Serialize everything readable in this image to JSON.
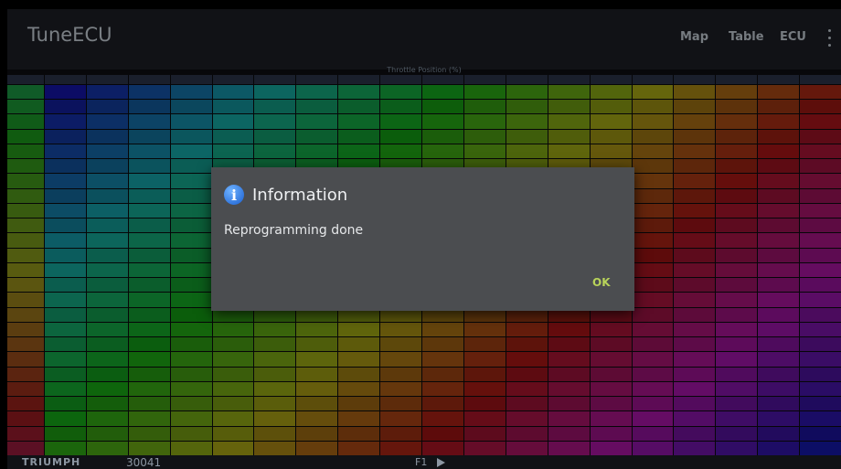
{
  "app": {
    "title": "TuneECU"
  },
  "menu": {
    "map": "Map",
    "table": "Table",
    "ecu": "ECU",
    "overflow_icon": "more-vert-icon"
  },
  "table": {
    "x_axis_caption": "Throttle Position (%)"
  },
  "dialog": {
    "icon": "info-icon",
    "title": "Information",
    "message": "Reprogramming done",
    "ok_label": "OK"
  },
  "status": {
    "brand": "TRIUMPH",
    "serial": "30041",
    "map_slot": "F1",
    "play_icon": "play-icon"
  },
  "colors": {
    "appbar": "#1c1e24",
    "dialog_bg": "#4b4d50",
    "ok_text": "#b8d35a",
    "info_icon": "#1a5fd0"
  }
}
